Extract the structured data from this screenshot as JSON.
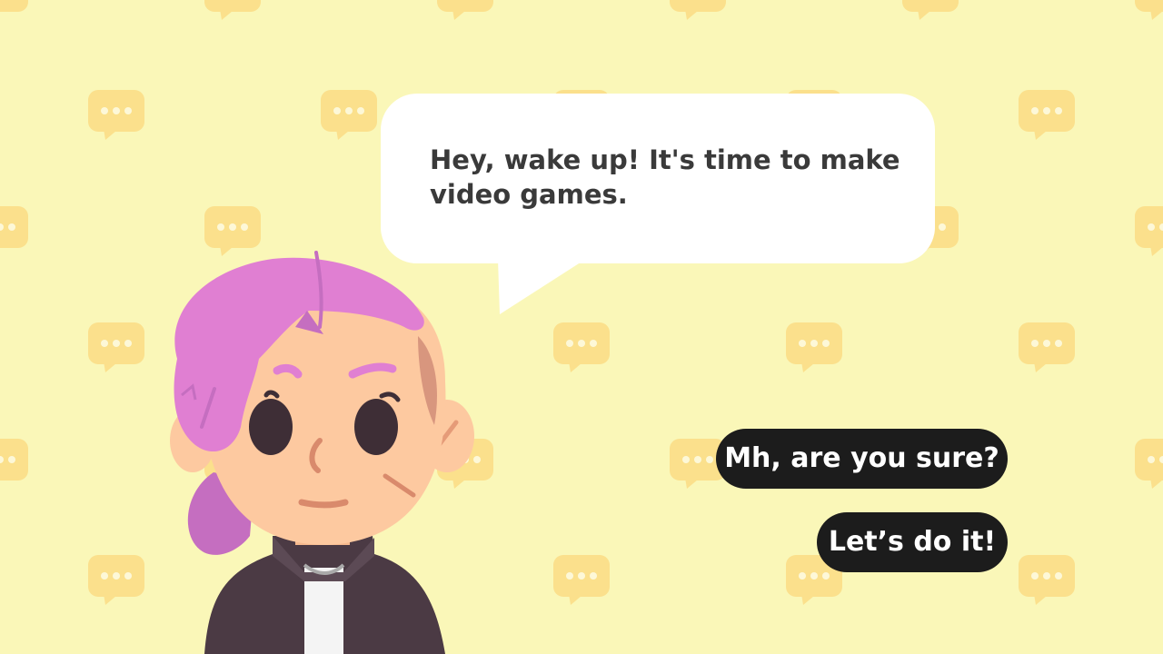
{
  "dialogue": {
    "line": "Hey, wake up! It's time to make video games."
  },
  "choices": [
    {
      "label": "Mh, are you sure?"
    },
    {
      "label": "Let’s do it!"
    }
  ],
  "colors": {
    "background": "#faf7b8",
    "pattern_icon": "#fbe08c",
    "bubble": "#ffffff",
    "dialogue_text": "#3a3a3a",
    "choice_bg": "#1c1c1c",
    "choice_text": "#ffffff",
    "hair": "#e07fd2",
    "skin": "#fdc9a0",
    "jacket": "#4b3a44",
    "shirt": "#f4f4f4"
  },
  "background_pattern_icon": "speech-bubble-icon"
}
